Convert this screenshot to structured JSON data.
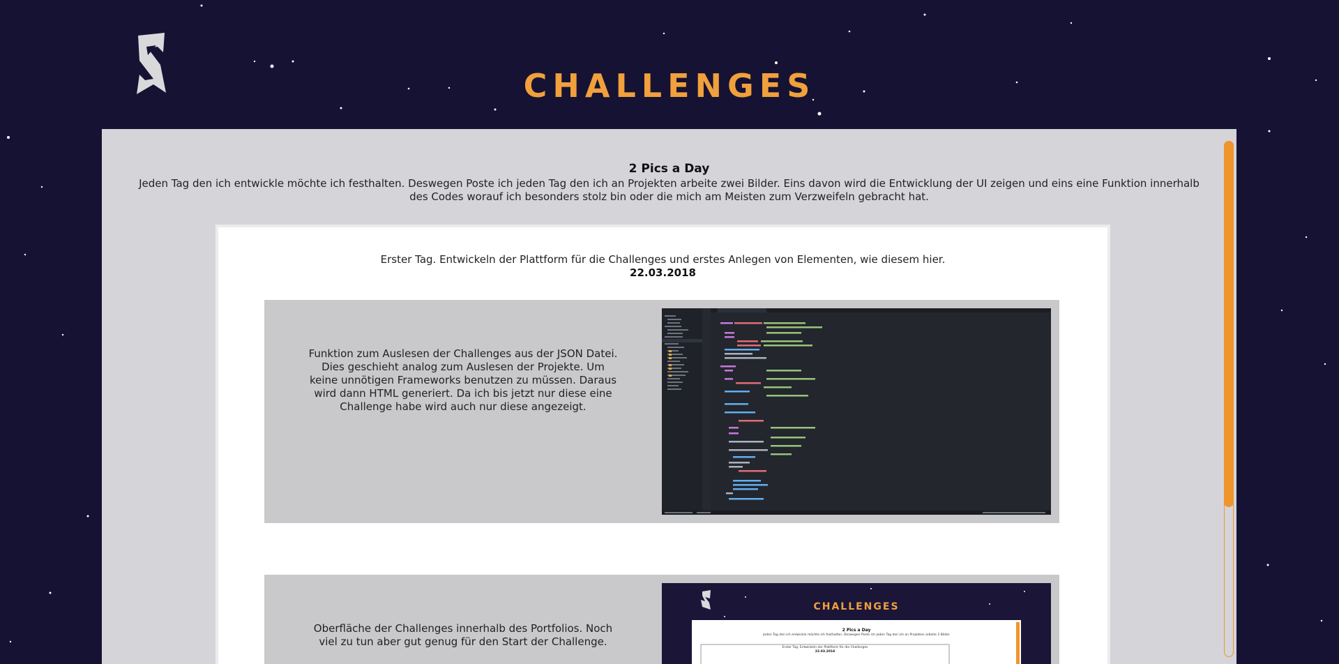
{
  "header": {
    "title": "CHALLENGES"
  },
  "intro": {
    "title": "2 Pics a Day",
    "text": "Jeden Tag den ich entwickle möchte ich festhalten. Deswegen Poste ich jeden Tag den ich an Projekten arbeite zwei Bilder. Eins davon wird die Entwicklung der UI zeigen und eins eine Funktion innerhalb des Codes worauf ich besonders stolz bin oder die mich am Meisten zum Verzweifeln gebracht hat."
  },
  "day": {
    "text": "Erster Tag. Entwickeln der Plattform für die Challenges und erstes Anlegen von Elementen, wie diesem hier.",
    "date": "22.03.2018",
    "entries": [
      {
        "text": "Funktion zum Auslesen der Challenges aus der JSON Datei. Dies geschieht analog zum Auslesen der Projekte. Um keine unnötigen Frameworks benutzen zu müssen. Daraus wird dann HTML generiert. Da ich bis jetzt nur diese eine Challenge habe wird auch nur diese angezeigt.",
        "image": "code-editor-screenshot"
      },
      {
        "text": "Oberfläche der Challenges innerhalb des Portfolios. Noch viel zu tun aber gut genug für den Start der Challenge.",
        "image": "ui-screenshot",
        "preview": {
          "title": "CHALLENGES",
          "intro_title": "2 Pics a Day",
          "intro_text": "Jeden Tag den ich entwickle möchte ich festhalten. Deswegen Poste ich jeden Tag den ich an Projekten arbeite 2 Bilder",
          "day_text": "Erster Tag. Entwickeln der Plattform für die Challenges",
          "date": "22.03.2018"
        }
      }
    ]
  },
  "colors": {
    "background": "#161233",
    "accent": "#f0a03c",
    "panel": "#d5d4d9",
    "card": "#ffffff",
    "entry": "#c9c9cb",
    "editor": "#23262d"
  },
  "icons": {
    "logo": "s-monogram-logo",
    "scrollbar": "scrollbar"
  }
}
